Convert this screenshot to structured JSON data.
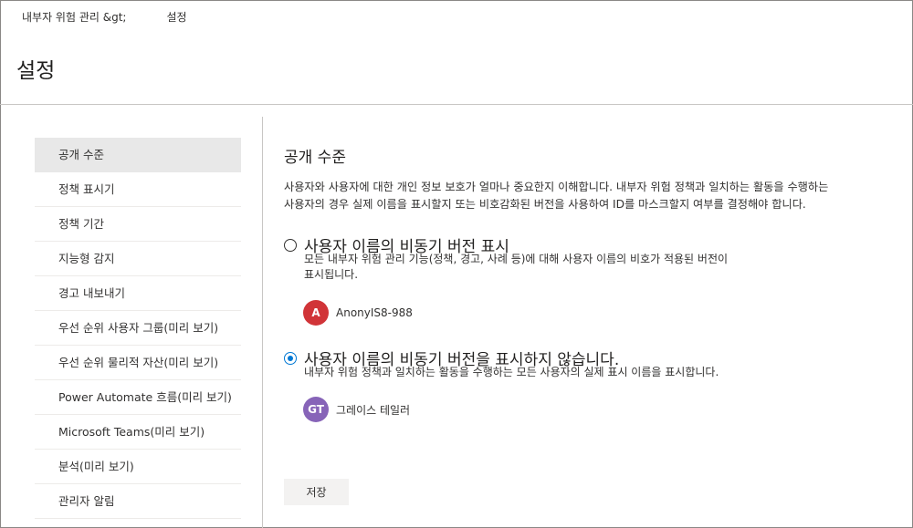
{
  "breadcrumb": {
    "parent": "내부자 위험 관리 &gt;",
    "current": "설정"
  },
  "page_title": "설정",
  "nav": {
    "items": [
      {
        "label": "공개 수준",
        "active": true
      },
      {
        "label": "정책 표시기"
      },
      {
        "label": "정책 기간"
      },
      {
        "label": "지능형 감지"
      },
      {
        "label": "경고 내보내기"
      },
      {
        "label": "우선 순위 사용자 그룹(미리 보기)"
      },
      {
        "label": "우선 순위 물리적 자산(미리 보기)"
      },
      {
        "label": "Power Automate 흐름(미리 보기)"
      },
      {
        "label": "Microsoft Teams(미리 보기)"
      },
      {
        "label": "분석(미리 보기)"
      },
      {
        "label": "관리자 알림"
      }
    ]
  },
  "main": {
    "section_title": "공개 수준",
    "description_line1": "사용자와 사용자에 대한 개인 정보 보호가 얼마나 중요한지 이해합니다. 내부자 위험 정책과 일치하는 활동을 수행하는",
    "description_line2": "사용자의 경우 실제 이름을 표시할지 또는 비호감화된 버전을 사용하여 ID를 마스크할지 여부를 결정해야 합니다.",
    "options": [
      {
        "label": "사용자 이름의 비동기 버전 표시",
        "desc_line1": "모든 내부자 위험 관리 기능(정책, 경고, 사례 등)에 대해 사용자 이름의 비호가 적용된 버전이",
        "desc_line2": "표시됩니다.",
        "checked": false,
        "persona": {
          "initials": "A",
          "name": "AnonyIS8-988",
          "color": "#d13438"
        }
      },
      {
        "label": "사용자 이름의 비동기 버전을 표시하지 않습니다.",
        "desc_line1": "내부자 위험 정책과 일치하는 활동을 수행하는 모든 사용자의 실제 표시 이름을 표시합니다.",
        "checked": true,
        "persona": {
          "initials": "GT",
          "name": "그레이스 테일러",
          "color": "#8764b8"
        }
      }
    ],
    "save_label": "저장"
  }
}
